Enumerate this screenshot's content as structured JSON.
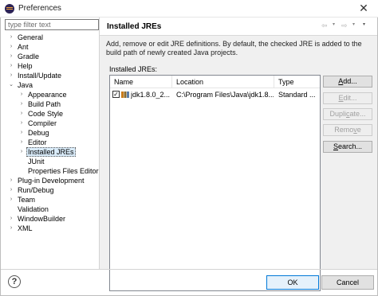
{
  "window": {
    "title": "Preferences",
    "close_symbol": "✕"
  },
  "filter": {
    "placeholder": "type filter text",
    "value": ""
  },
  "tree": [
    {
      "label": "General",
      "arrow": "›",
      "expanded": false
    },
    {
      "label": "Ant",
      "arrow": "›",
      "expanded": false
    },
    {
      "label": "Gradle",
      "arrow": "›",
      "expanded": false
    },
    {
      "label": "Help",
      "arrow": "›",
      "expanded": false
    },
    {
      "label": "Install/Update",
      "arrow": "›",
      "expanded": false
    },
    {
      "label": "Java",
      "arrow": "⌄",
      "expanded": true
    },
    {
      "label": "Appearance",
      "arrow": "›",
      "expanded": false
    },
    {
      "label": "Build Path",
      "arrow": "›",
      "expanded": false
    },
    {
      "label": "Code Style",
      "arrow": "›",
      "expanded": false
    },
    {
      "label": "Compiler",
      "arrow": "›",
      "expanded": false
    },
    {
      "label": "Debug",
      "arrow": "›",
      "expanded": false
    },
    {
      "label": "Editor",
      "arrow": "›",
      "expanded": false
    },
    {
      "label": "Installed JREs",
      "arrow": "›",
      "expanded": false,
      "selected": true
    },
    {
      "label": "JUnit",
      "arrow": "",
      "expanded": false
    },
    {
      "label": "Properties Files Editor",
      "arrow": "",
      "expanded": false
    },
    {
      "label": "Plug-in Development",
      "arrow": "›",
      "expanded": false
    },
    {
      "label": "Run/Debug",
      "arrow": "›",
      "expanded": false
    },
    {
      "label": "Team",
      "arrow": "›",
      "expanded": false
    },
    {
      "label": "Validation",
      "arrow": "",
      "expanded": false
    },
    {
      "label": "WindowBuilder",
      "arrow": "›",
      "expanded": false
    },
    {
      "label": "XML",
      "arrow": "›",
      "expanded": false
    }
  ],
  "page": {
    "title": "Installed JREs",
    "description": "Add, remove or edit JRE definitions. By default, the checked JRE is added to the build path of newly created Java projects.",
    "installed_label": "Installed JREs:"
  },
  "nav": {
    "back": "⇦",
    "forward": "⇨",
    "dropdown": "▾"
  },
  "table": {
    "columns": [
      "Name",
      "Location",
      "Type"
    ],
    "rows": [
      {
        "checked": true,
        "check_mark": "✓",
        "name": "jdk1.8.0_2...",
        "location": "C:\\Program Files\\Java\\jdk1.8....",
        "type": "Standard ..."
      }
    ]
  },
  "buttons": {
    "add": {
      "mnemonic": "A",
      "rest": "dd...",
      "enabled": true
    },
    "edit": {
      "mnemonic": "E",
      "rest": "dit...",
      "enabled": false
    },
    "duplicate": {
      "pre": "Dupli",
      "mnemonic": "c",
      "rest": "ate...",
      "enabled": false
    },
    "remove": {
      "pre": "Remo",
      "mnemonic": "v",
      "rest": "e",
      "enabled": false
    },
    "search": {
      "mnemonic": "S",
      "rest": "earch...",
      "enabled": true
    }
  },
  "footer": {
    "help": "?",
    "ok": "OK",
    "cancel": "Cancel"
  },
  "colors": {
    "selection": "#d9ebf9",
    "ok_border": "#0078d7",
    "jre_icon": "#c97c1c"
  }
}
